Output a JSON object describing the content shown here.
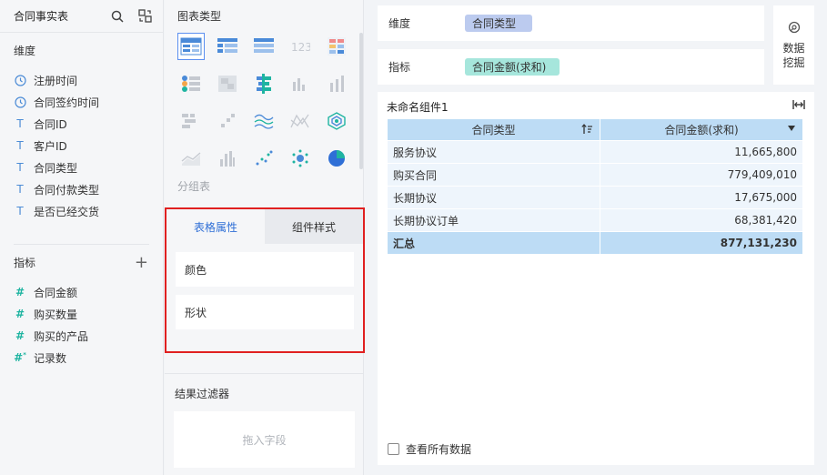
{
  "left": {
    "title": "合同事实表",
    "dimensions_label": "维度",
    "dimensions": [
      {
        "label": "注册时间",
        "icon": "clock-icon"
      },
      {
        "label": "合同签约时间",
        "icon": "clock-icon"
      },
      {
        "label": "合同ID",
        "icon": "text-T-icon"
      },
      {
        "label": "客户ID",
        "icon": "text-T-icon"
      },
      {
        "label": "合同类型",
        "icon": "text-T-icon"
      },
      {
        "label": "合同付款类型",
        "icon": "text-T-icon"
      },
      {
        "label": "是否已经交货",
        "icon": "text-T-icon"
      }
    ],
    "measures_label": "指标",
    "measures": [
      {
        "label": "合同金额",
        "icon": "hash-icon"
      },
      {
        "label": "购买数量",
        "icon": "hash-icon"
      },
      {
        "label": "购买的产品",
        "icon": "hash-icon"
      },
      {
        "label": "记录数",
        "icon": "hash-star-icon"
      }
    ]
  },
  "mid": {
    "chart_type_label": "图表类型",
    "group_table_label": "分组表",
    "tabs": [
      "表格属性",
      "组件样式"
    ],
    "props": [
      "颜色",
      "形状"
    ],
    "filter_label": "结果过滤器",
    "drop_placeholder": "拖入字段"
  },
  "right": {
    "dim_label": "维度",
    "dim_pill": "合同类型",
    "mea_label": "指标",
    "mea_pill": "合同金额(求和)",
    "mining_line1": "数据",
    "mining_line2": "挖掘",
    "widget_title": "未命名组件1",
    "table": {
      "headers": [
        "合同类型",
        "合同金额(求和)"
      ],
      "rows": [
        [
          "服务协议",
          "11,665,800"
        ],
        [
          "购买合同",
          "779,409,010"
        ],
        [
          "长期协议",
          "17,675,000"
        ],
        [
          "长期协议订单",
          "68,381,420"
        ]
      ],
      "total": [
        "汇总",
        "877,131,230"
      ]
    },
    "view_all": "查看所有数据"
  },
  "colors": {
    "accent": "#2f6fd6",
    "dimension_pill": "#bccbef",
    "measure_pill": "#a6e6dc",
    "table_header": "#bddcf5",
    "highlight_box": "#e02020"
  }
}
